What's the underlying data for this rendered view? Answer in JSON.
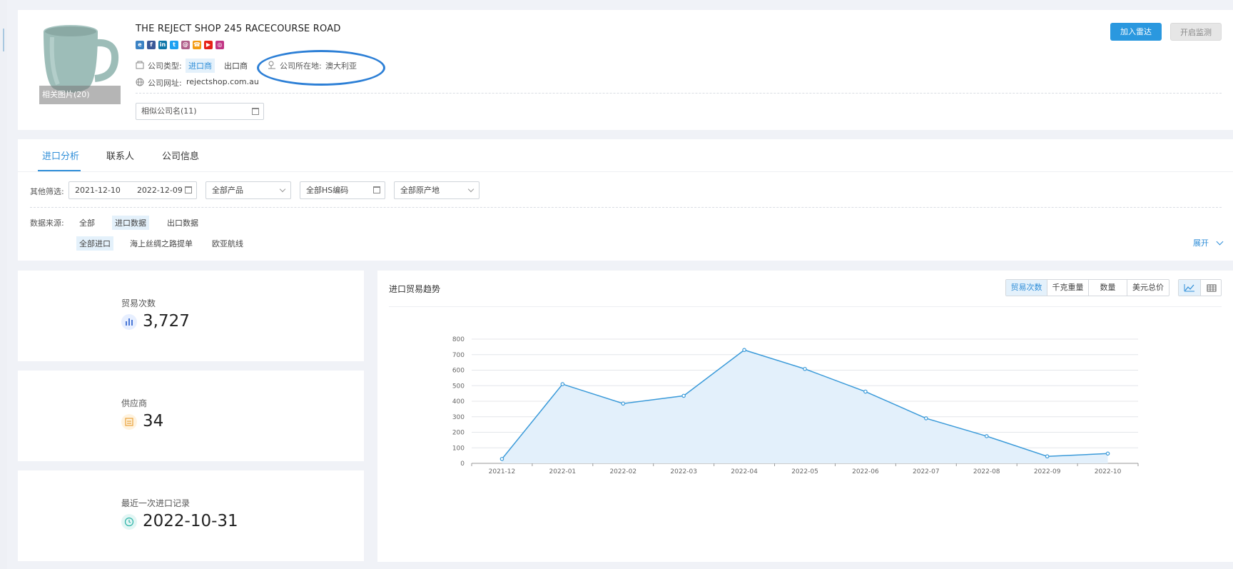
{
  "company": {
    "photo_caption": "相关图片(20)",
    "name": "THE REJECT SHOP 245 RACECOURSE ROAD",
    "type_label": "公司类型:",
    "types": [
      "进口商",
      "出口商"
    ],
    "location_label": "公司所在地:",
    "location": "澳大利亚",
    "website_label": "公司网址:",
    "website": "rejectshop.com.au",
    "similar_label": "相似公司名(11)",
    "social_icons": [
      "ie-icon",
      "facebook-icon",
      "linkedin-icon",
      "twitter-icon",
      "email-icon",
      "phone-icon",
      "youtube-icon",
      "instagram-icon"
    ]
  },
  "actions": {
    "add_radar": "加入雷达",
    "monitor": "开启监测"
  },
  "tabs": [
    "进口分析",
    "联系人",
    "公司信息"
  ],
  "filters": {
    "label": "其他筛选:",
    "date_start": "2021-12-10",
    "date_end": "2022-12-09",
    "product": "全部产品",
    "hs_code": "全部HS编码",
    "origin": "全部原产地"
  },
  "source": {
    "label": "数据来源:",
    "options": [
      "全部",
      "进口数据",
      "出口数据"
    ],
    "sub_options": [
      "全部进口",
      "海上丝绸之路提单",
      "欧亚航线"
    ],
    "expand": "展开"
  },
  "stats": [
    {
      "label": "贸易次数",
      "value": "3,727"
    },
    {
      "label": "供应商",
      "value": "34"
    },
    {
      "label": "最近一次进口记录",
      "value": "2022-10-31"
    }
  ],
  "chart_panel": {
    "title": "进口贸易趋势",
    "metrics": [
      "贸易次数",
      "千克重量",
      "数量",
      "美元总价"
    ]
  },
  "colors": {
    "accent": "#2f8ed8",
    "line": "#3a9ad9",
    "area": "#e3f0fb"
  },
  "chart_data": {
    "type": "area",
    "categories": [
      "2021-12",
      "2022-01",
      "2022-02",
      "2022-03",
      "2022-04",
      "2022-05",
      "2022-06",
      "2022-07",
      "2022-08",
      "2022-09",
      "2022-10"
    ],
    "values": [
      28,
      510,
      385,
      435,
      730,
      608,
      462,
      290,
      175,
      45,
      63
    ],
    "ylim": [
      0,
      800
    ],
    "yticks": [
      "0",
      "100",
      "200",
      "300",
      "400",
      "500",
      "600",
      "700",
      "800"
    ],
    "grid": true
  }
}
